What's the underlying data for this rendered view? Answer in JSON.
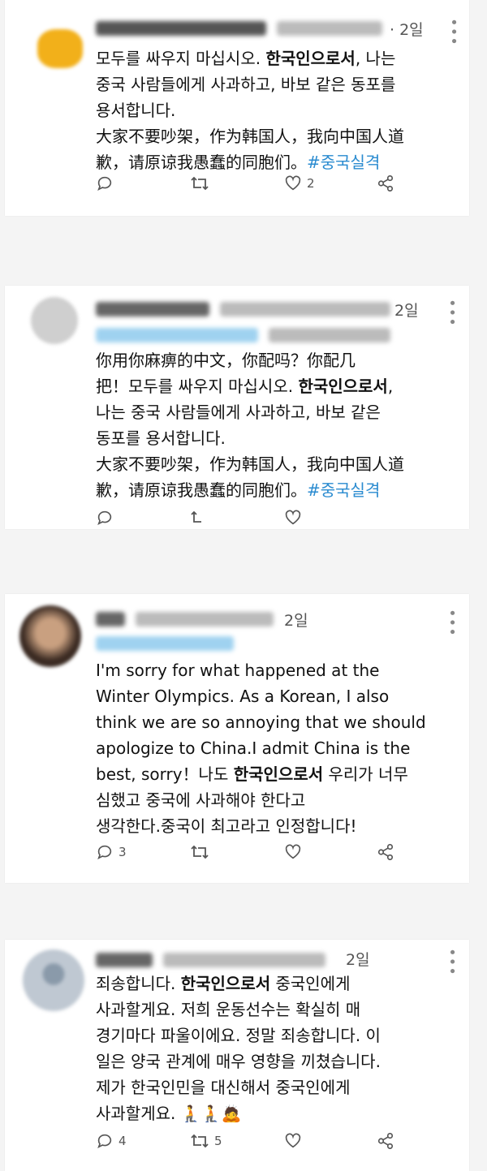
{
  "tweets": [
    {
      "time": "· 2일",
      "line1": "모두를 싸우지 마십시오. ",
      "bold1": "한국인으로서",
      "line1b": ", 나는",
      "line2": "중국 사람들에게 사과하고, 바보 같은 동포를",
      "line3": "용서합니다.",
      "line4": "大家不要吵架，作为韩国人，我向中国人道",
      "line5": "歉，请原谅我愚蠢的同胞们。",
      "hashtag": "#중국실격",
      "likes": "2"
    },
    {
      "time": "2일",
      "line1": "你用你麻痹的中文，你配吗？你配几",
      "line2a": "把！모두를 싸우지 마십시오. ",
      "bold2": "한국인으로서",
      "line2b": ",",
      "line3": "나는 중국 사람들에게 사과하고, 바보 같은",
      "line4": "동포를 용서합니다.",
      "line5": "大家不要吵架，作为韩国人，我向中国人道",
      "line6": "歉，请原谅我愚蠢的同胞们。",
      "hashtag": "#중국실격"
    },
    {
      "time": "2일",
      "line1": "I'm sorry for what happened at the",
      "line2": "Winter Olympics. As a Korean, I also",
      "line3": "think we are so annoying that we should",
      "line4": "apologize to China.I admit China is the",
      "line5a": "best, sorry！나도 ",
      "bold5": "한국인으로서",
      "line5b": " 우리가 너무",
      "line6": "심했고 중국에 사과해야 한다고",
      "line7": "생각한다.중국이 최고라고 인정합니다!",
      "replies": "3"
    },
    {
      "time": "2일",
      "line1a": "죄송합니다. ",
      "bold1": "한국인으로서",
      "line1b": " 중국인에게",
      "line2": "사과할게요. 저희 운동선수는 확실히 매",
      "line3": "경기마다 파울이에요. 정말 죄송합니다. 이",
      "line4": "일은 양국 관계에 매우 영향을 끼쳤습니다.",
      "line5": "제가 한국인민을 대신해서 중국인에게",
      "line6": "사과할게요. 🧎🧎🙇",
      "replies": "4",
      "retweets": "5"
    }
  ]
}
